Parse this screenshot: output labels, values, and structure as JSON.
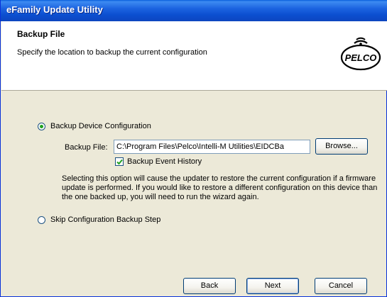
{
  "window": {
    "title": "eFamily Update Utility"
  },
  "header": {
    "title": "Backup File",
    "subtitle": "Specify the location to backup the current configuration",
    "logo_text": "PELCO"
  },
  "options": {
    "backup_device": {
      "label": "Backup Device Configuration",
      "selected": true
    },
    "backup_file": {
      "label": "Backup File:",
      "value": "C:\\Program Files\\Pelco\\Intelli-M Utilities\\EIDCBa"
    },
    "browse_label": "Browse...",
    "event_history": {
      "label": "Backup Event History",
      "checked": true
    },
    "description": "Selecting this option will cause the updater to restore the current configuration if a firmware update is performed.  If you would like to restore a different configuration on this device than the one backed up, you will need to run the wizard again.",
    "skip": {
      "label": "Skip Configuration Backup Step",
      "selected": false
    }
  },
  "buttons": {
    "back": "Back",
    "next": "Next",
    "cancel": "Cancel"
  },
  "colors": {
    "titlebar": "#0b4fd0",
    "radio_dot": "#21a121",
    "background": "#ece9d8"
  }
}
